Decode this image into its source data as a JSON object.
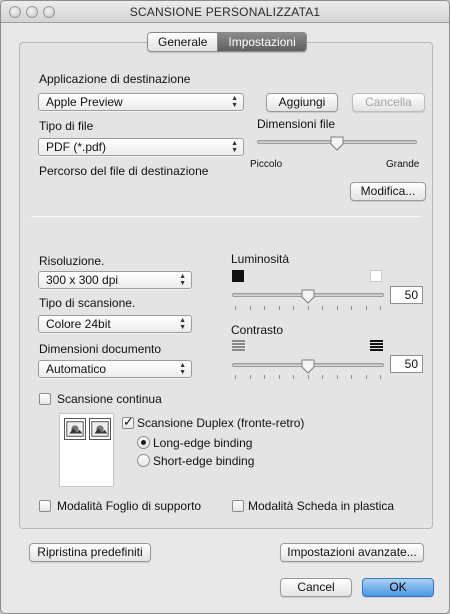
{
  "window": {
    "title": "SCANSIONE PERSONALIZZATA1"
  },
  "tabs": [
    {
      "label": "Generale",
      "selected": false
    },
    {
      "label": "Impostazioni",
      "selected": true
    }
  ],
  "destination": {
    "label": "Applicazione di destinazione",
    "selected_app": "Apple Preview",
    "add_button": "Aggiungi",
    "delete_button": "Cancella"
  },
  "file_type": {
    "label": "Tipo di file",
    "selected": "PDF (*.pdf)"
  },
  "file_size": {
    "label": "Dimensioni file",
    "min_label": "Piccolo",
    "max_label": "Grande",
    "level": 0.5
  },
  "destination_path": {
    "label": "Percorso del file di destinazione",
    "modify_button": "Modifica..."
  },
  "resolution": {
    "label": "Risoluzione.",
    "selected": "300 x 300 dpi"
  },
  "scan_type": {
    "label": "Tipo di scansione.",
    "selected": "Colore 24bit"
  },
  "doc_size": {
    "label": "Dimensioni documento",
    "selected": "Automatico"
  },
  "brightness": {
    "label": "Luminosità",
    "value": "50",
    "level": 0.5
  },
  "contrast": {
    "label": "Contrasto",
    "value": "50",
    "level": 0.5
  },
  "continuous_scan": {
    "label": "Scansione continua",
    "checked": false
  },
  "duplex": {
    "label": "Scansione Duplex (fronte-retro)",
    "checked": true,
    "long_edge": "Long-edge binding",
    "short_edge": "Short-edge binding",
    "selected_binding": "long"
  },
  "carrier_sheet": {
    "label": "Modalità Foglio di supporto",
    "checked": false
  },
  "plastic_card": {
    "label": "Modalità Scheda in plastica",
    "checked": false
  },
  "footer": {
    "restore_defaults": "Ripristina predefiniti",
    "advanced_settings": "Impostazioni avanzate...",
    "cancel": "Cancel",
    "ok": "OK"
  }
}
